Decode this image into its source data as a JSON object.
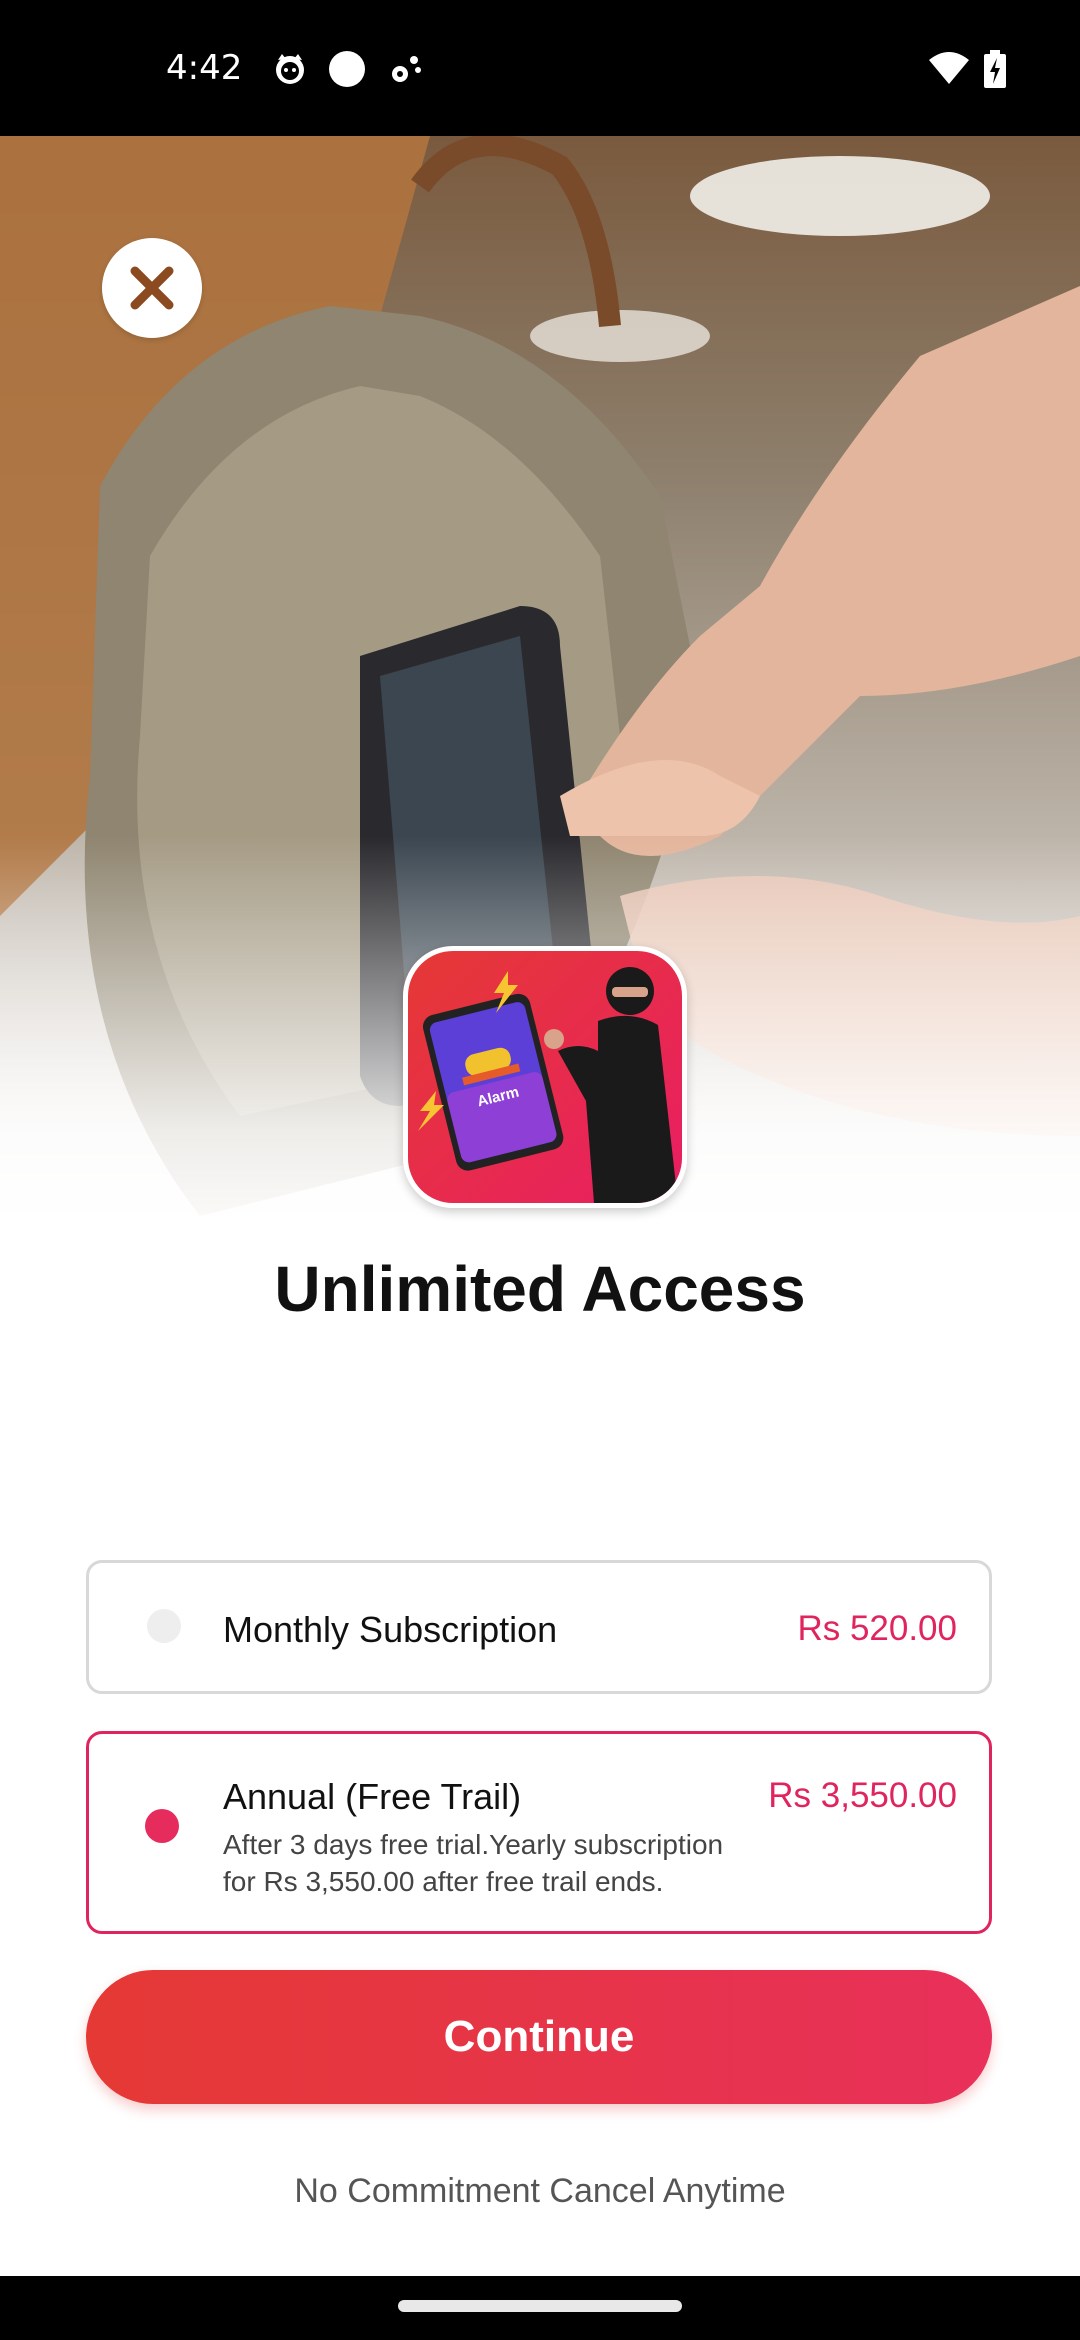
{
  "status_bar": {
    "time": "4:42",
    "icons_left": [
      "cat-face-icon",
      "circle-icon",
      "settings-dots-icon"
    ],
    "icons_right": [
      "wifi-icon",
      "battery-charging-icon"
    ]
  },
  "hero": {
    "close_icon": "close-icon",
    "app_icon_text": "Alarm"
  },
  "title": "Unlimited Access",
  "plans": [
    {
      "label": "Monthly Subscription",
      "price": "Rs 520.00",
      "selected": false
    },
    {
      "label": "Annual (Free Trail)",
      "price": "Rs 3,550.00",
      "description_line1": "After 3 days free trial.Yearly subscription",
      "description_line2": "for Rs 3,550.00 after free trail ends.",
      "selected": true
    }
  ],
  "continue_label": "Continue",
  "footnote": "No Commitment Cancel Anytime",
  "colors": {
    "accent": "#e0245e",
    "button_start": "#e53935",
    "button_end": "#e8305a"
  }
}
